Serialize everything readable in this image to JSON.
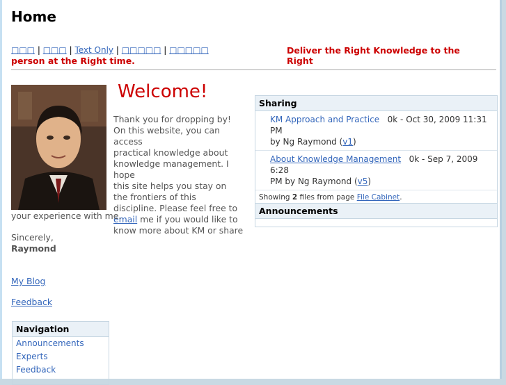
{
  "header": {
    "title": "Home"
  },
  "lang_links": [
    "□□□",
    "□□□",
    "Text Only",
    "□□□□□",
    "□□□□□"
  ],
  "lang_sep": "|",
  "tagline": {
    "line1": "Deliver the Right Knowledge to the Right",
    "line2": "person at the Right time."
  },
  "main": {
    "welcome": "Welcome!",
    "intro_lines": [
      "Thank you for dropping by!",
      "On this website, you can access",
      "practical knowledge about",
      "knowledge management. I hope",
      "this site helps you stay on",
      "the frontiers of this",
      "discipline.  Please feel free to"
    ],
    "email_link": "email",
    "intro_after_email": " me if you would like to",
    "intro_line_know": "know more about KM or share",
    "intro_tail": "your experience with me.",
    "sincerely": "Sincerely,",
    "signature": "Raymond",
    "blog_link": "My Blog",
    "feedback_link": "Feedback"
  },
  "navigation": {
    "title": "Navigation",
    "items": [
      "Announcements",
      "Experts",
      "Feedback"
    ]
  },
  "sharing": {
    "title": "Sharing",
    "files": [
      {
        "name": "KM Approach and Practice",
        "size": "0k",
        "sep": " - ",
        "date": "Oct 30, 2009 11:31 PM",
        "by": "by Ng Raymond (",
        "version": "v1",
        "close": ")"
      },
      {
        "name": "About Knowledge Management",
        "size": "0k",
        "sep": " - ",
        "date": "Sep 7, 2009 6:28",
        "date2": "PM",
        "by": "by Ng Raymond (",
        "version": "v5",
        "close": ")"
      }
    ],
    "footer_prefix": "Showing ",
    "footer_count": "2",
    "footer_mid": " files from page ",
    "footer_link": "File Cabinet",
    "footer_end": "."
  },
  "announcements": {
    "title": "Announcements"
  },
  "colors": {
    "accent_red": "#cc0000",
    "link_blue": "#3366bb",
    "panel_header": "#eaf1f7"
  }
}
